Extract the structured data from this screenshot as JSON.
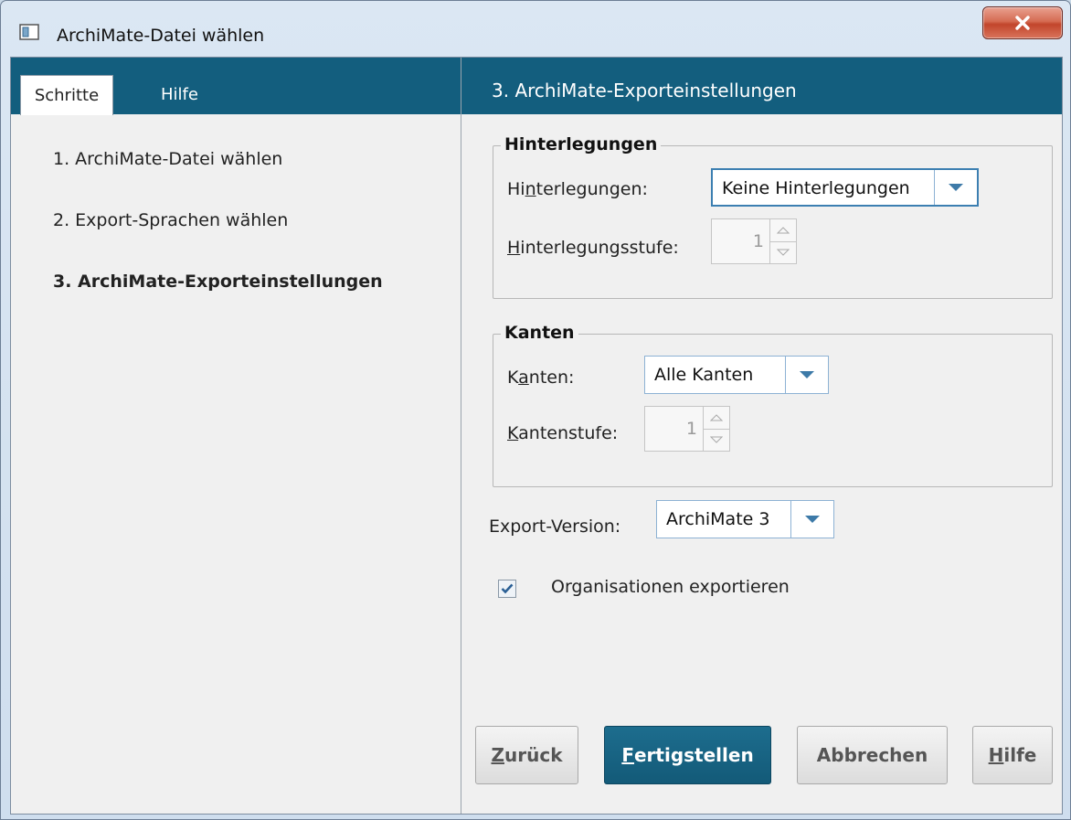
{
  "window": {
    "title": "ArchiMate-Datei wählen",
    "close_label": "X"
  },
  "left": {
    "tabs": [
      {
        "label": "Schritte",
        "active": true
      },
      {
        "label": "Hilfe",
        "active": false
      }
    ],
    "steps": [
      {
        "label": "1. ArchiMate-Datei wählen",
        "current": false
      },
      {
        "label": "2. Export-Sprachen wählen",
        "current": false
      },
      {
        "label": "3. ArchiMate-Exporteinstellungen",
        "current": true
      }
    ]
  },
  "right": {
    "header": "3. ArchiMate-Exporteinstellungen",
    "hinterlegungen": {
      "group_title": "Hinterlegungen",
      "label_pre": "Hi",
      "label_mnemonic": "n",
      "label_post": "terlegungen:",
      "value": "Keine Hinterlegungen",
      "level_mnemonic": "H",
      "level_post": "interlegungsstufe:",
      "level_value": "1"
    },
    "kanten": {
      "group_title": "Kanten",
      "label_pre": "K",
      "label_mnemonic": "a",
      "label_post": "nten:",
      "value": "Alle Kanten",
      "level_mnemonic": "K",
      "level_post": "antenstufe:",
      "level_value": "1"
    },
    "export_version": {
      "label": "Export-Version:",
      "value": "ArchiMate 3"
    },
    "organisationen": {
      "label": "Organisationen exportieren",
      "checked": true
    }
  },
  "buttons": {
    "back_mnemonic": "Z",
    "back_rest": "urück",
    "finish_mnemonic": "F",
    "finish_rest": "ertigstellen",
    "cancel": "Abbrechen",
    "help_mnemonic": "H",
    "help_rest": "ilfe"
  },
  "colors": {
    "header_blue": "#135e7e",
    "panel_bg": "#f0f0f0"
  },
  "icons": {
    "window": "window-icon",
    "close": "close-icon",
    "dropdown": "chevron-down-icon",
    "spin_up": "spin-up-icon",
    "spin_down": "spin-down-icon",
    "check": "check-icon"
  }
}
